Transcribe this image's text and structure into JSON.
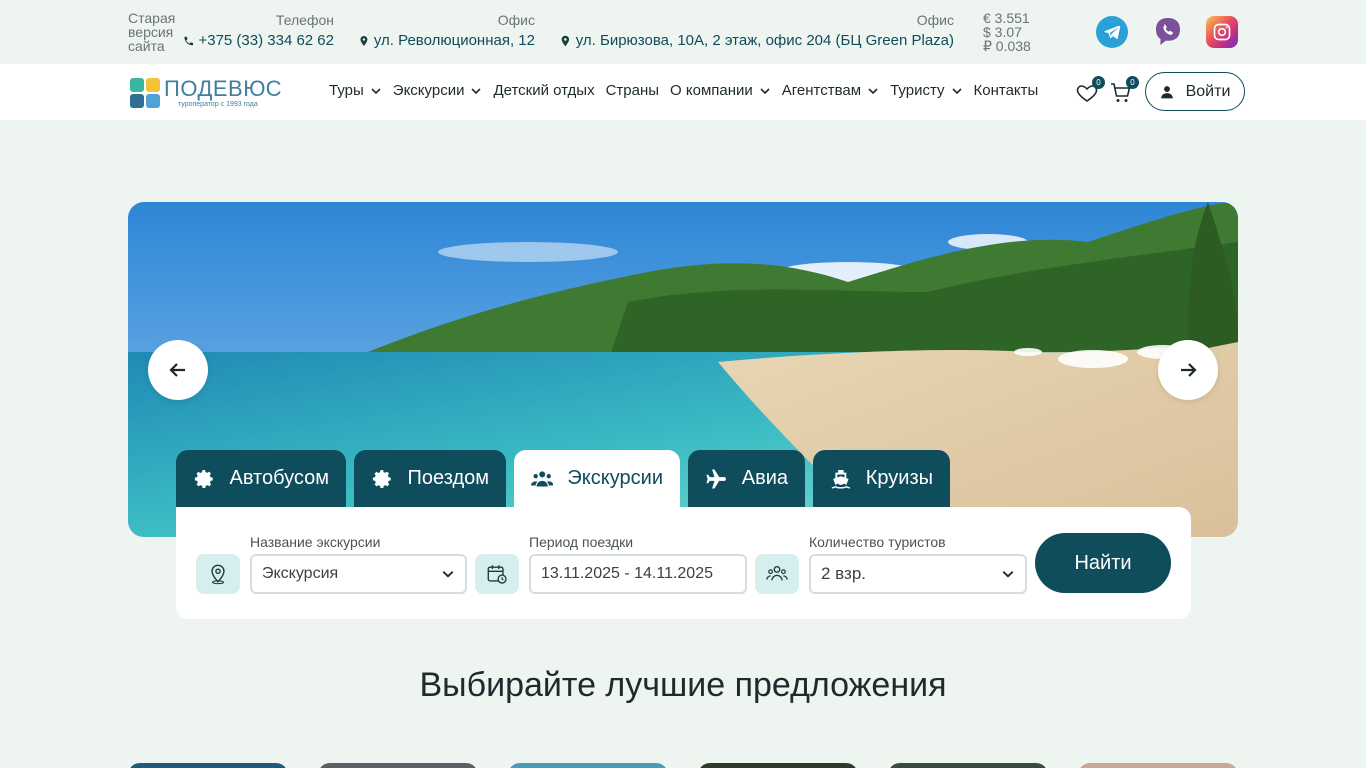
{
  "topbar": {
    "old_site": "Старая версия сайта",
    "phone_label": "Телефон",
    "phone_value": "+375 (33) 334 62 62",
    "office1_label": "Офис",
    "office1_value": "ул. Революционная, 12",
    "office2_label": "Офис",
    "office2_value": "ул. Бирюзова, 10А, 2 этаж, офис 204 (БЦ Green Plaza)",
    "currency": [
      "€ 3.551",
      "$ 3.07",
      "₽ 0.038"
    ],
    "social": [
      "telegram-icon",
      "viber-icon",
      "instagram-icon"
    ]
  },
  "nav": {
    "logo_name": "ПОДЕВЮС",
    "logo_sub": "туроператор с 1993 года",
    "menu": [
      {
        "label": "Туры",
        "dropdown": true
      },
      {
        "label": "Экскурсии",
        "dropdown": true
      },
      {
        "label": "Детский отдых",
        "dropdown": false
      },
      {
        "label": "Страны",
        "dropdown": false
      },
      {
        "label": "О компании",
        "dropdown": true
      },
      {
        "label": "Агентствам",
        "dropdown": true
      },
      {
        "label": "Туристу",
        "dropdown": true
      },
      {
        "label": "Контакты",
        "dropdown": false
      }
    ],
    "favorites_count": "0",
    "cart_count": "0",
    "login_label": "Войти"
  },
  "search": {
    "tabs": [
      {
        "label": "Автобусом",
        "icon": "gear-icon",
        "active": false
      },
      {
        "label": "Поездом",
        "icon": "gear-icon",
        "active": false
      },
      {
        "label": "Экскурсии",
        "icon": "users-icon",
        "active": true
      },
      {
        "label": "Авиа",
        "icon": "plane-icon",
        "active": false
      },
      {
        "label": "Круизы",
        "icon": "ship-icon",
        "active": false
      }
    ],
    "name_label": "Название экскурсии",
    "name_value": "Экскурсия",
    "period_label": "Период поездки",
    "period_value": "13.11.2025 - 14.11.2025",
    "tourists_label": "Количество туристов",
    "tourists_value": "2 взр.",
    "find_label": "Найти"
  },
  "section": {
    "title": "Выбирайте лучшие предложения"
  },
  "colors": {
    "primary": "#0f4c5c",
    "background": "#eef4f0",
    "icon_bg": "#d7eeee"
  }
}
